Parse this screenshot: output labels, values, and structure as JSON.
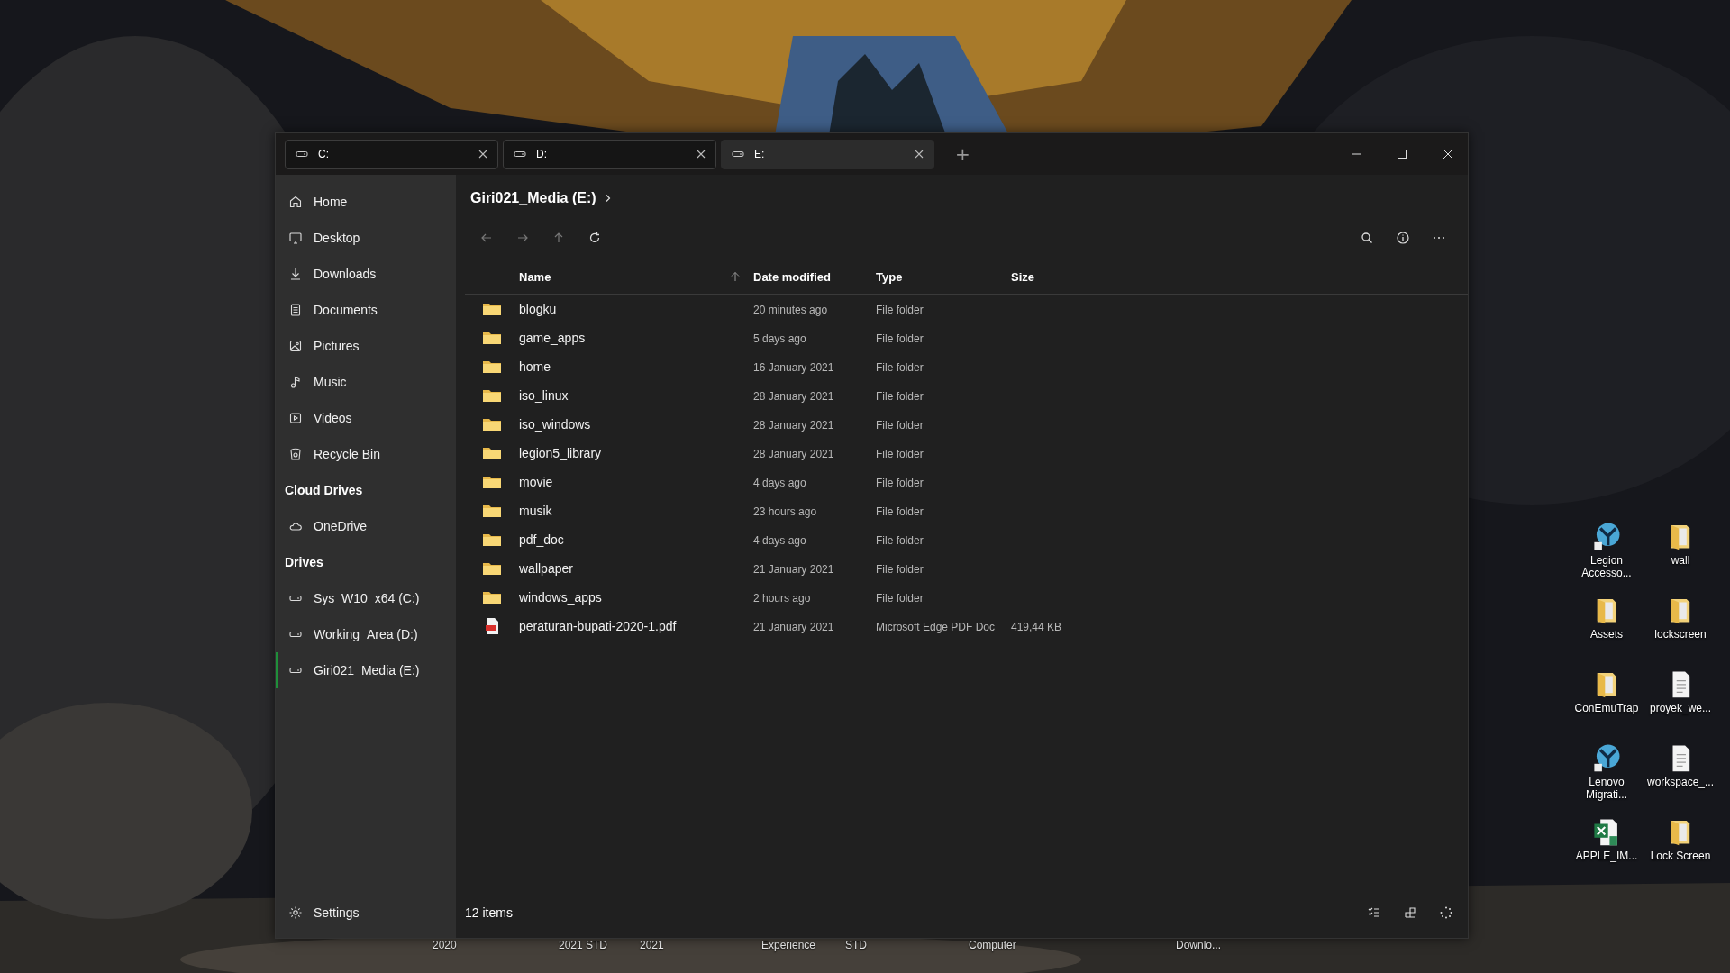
{
  "tabs": [
    {
      "label": "C:",
      "selected": false
    },
    {
      "label": "D:",
      "selected": false
    },
    {
      "label": "E:",
      "selected": true
    }
  ],
  "new_tab": "+",
  "sidebar": {
    "sections": [
      {
        "items": [
          {
            "label": "Home",
            "kind": "home",
            "selected": false
          },
          {
            "label": "Desktop",
            "kind": "desktop",
            "selected": false
          },
          {
            "label": "Downloads",
            "kind": "download",
            "selected": false
          },
          {
            "label": "Documents",
            "kind": "document",
            "selected": false
          },
          {
            "label": "Pictures",
            "kind": "picture",
            "selected": false
          },
          {
            "label": "Music",
            "kind": "music",
            "selected": false
          },
          {
            "label": "Videos",
            "kind": "video",
            "selected": false
          },
          {
            "label": "Recycle Bin",
            "kind": "bin",
            "selected": false
          }
        ]
      },
      {
        "heading": "Cloud Drives",
        "items": [
          {
            "label": "OneDrive",
            "kind": "cloud",
            "selected": false
          }
        ]
      },
      {
        "heading": "Drives",
        "items": [
          {
            "label": "Sys_W10_x64 (C:)",
            "kind": "drive",
            "selected": false
          },
          {
            "label": "Working_Area (D:)",
            "kind": "drive",
            "selected": false
          },
          {
            "label": "Giri021_Media (E:)",
            "kind": "drive",
            "selected": true
          }
        ]
      }
    ],
    "settings": "Settings"
  },
  "breadcrumb": "Giri021_Media (E:)",
  "table": {
    "columns": [
      "Name",
      "Date modified",
      "Type",
      "Size"
    ],
    "rows": [
      {
        "name": "blogku",
        "date": "20 minutes ago",
        "type": "File folder",
        "kind": "folder"
      },
      {
        "name": "game_apps",
        "date": "5 days ago",
        "type": "File folder",
        "kind": "folder"
      },
      {
        "name": "home",
        "date": "16 January 2021",
        "type": "File folder",
        "kind": "folder"
      },
      {
        "name": "iso_linux",
        "date": "28 January 2021",
        "type": "File folder",
        "kind": "folder"
      },
      {
        "name": "iso_windows",
        "date": "28 January 2021",
        "type": "File folder",
        "kind": "folder"
      },
      {
        "name": "legion5_library",
        "date": "28 January 2021",
        "type": "File folder",
        "kind": "folder"
      },
      {
        "name": "movie",
        "date": "4 days ago",
        "type": "File folder",
        "kind": "folder"
      },
      {
        "name": "musik",
        "date": "23 hours ago",
        "type": "File folder",
        "kind": "folder"
      },
      {
        "name": "pdf_doc",
        "date": "4 days ago",
        "type": "File folder",
        "kind": "folder"
      },
      {
        "name": "wallpaper",
        "date": "21 January 2021",
        "type": "File folder",
        "kind": "folder"
      },
      {
        "name": "windows_apps",
        "date": "2 hours ago",
        "type": "File folder",
        "kind": "folder"
      },
      {
        "name": "peraturan-bupati-2020-1.pdf",
        "date": "21 January 2021",
        "type": "Microsoft Edge PDF Doc",
        "size": "419,44 KB",
        "kind": "pdf"
      }
    ]
  },
  "status_bar": {
    "count": "12 items"
  },
  "desktop_icons": [
    {
      "label": "Legion Accesso...",
      "kind": "app"
    },
    {
      "label": "wall",
      "kind": "folder"
    },
    {
      "label": "Assets",
      "kind": "folder"
    },
    {
      "label": "lockscreen",
      "kind": "folder"
    },
    {
      "label": "ConEmuTrap",
      "kind": "folder"
    },
    {
      "label": "proyek_we...",
      "kind": "document"
    },
    {
      "label": "Lenovo Migrati...",
      "kind": "app"
    },
    {
      "label": "workspace_...",
      "kind": "document"
    },
    {
      "label": "APPLE_IM...",
      "kind": "spreadsheet"
    },
    {
      "label": "Lock Screen",
      "kind": "folder"
    }
  ],
  "hidden_icon_labels": [
    "2020",
    "2021 STD",
    "2021",
    "Experience",
    "STD",
    "Computer",
    "Downlo..."
  ]
}
